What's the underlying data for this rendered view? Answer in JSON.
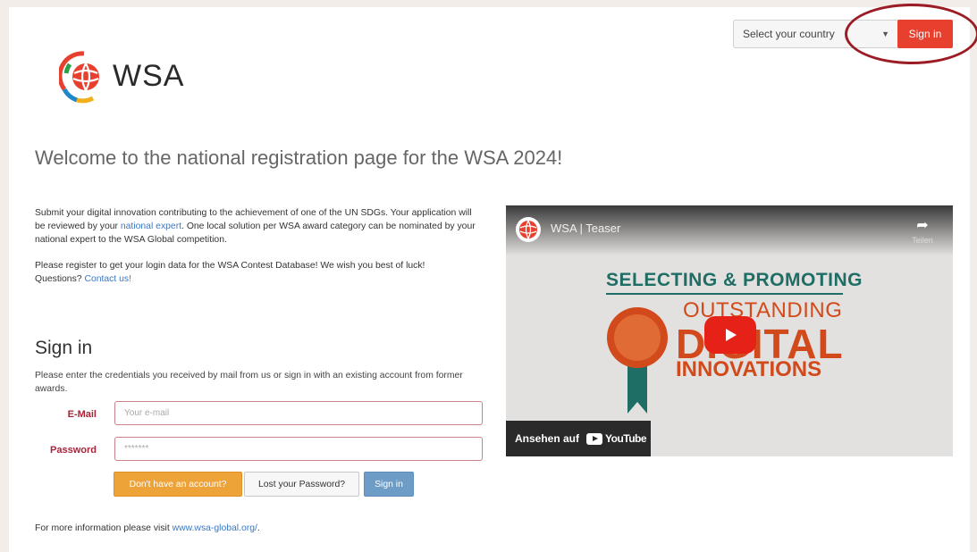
{
  "header": {
    "logo_text": "WSA",
    "country_select": {
      "value": "Select your country"
    },
    "signin_button": "Sign in"
  },
  "main": {
    "welcome_title": "Welcome to the national registration page for the WSA 2024!",
    "intro": {
      "p1_before": "Submit your digital innovation contributing to the achievement of one of the UN SDGs. Your application will be reviewed by your ",
      "p1_link": "national expert",
      "p1_after": ". One local solution per WSA award category can be nominated by your national expert to the WSA Global competition.",
      "p2": "Please register to get your login data for the WSA Contest Database! We wish you best of luck!",
      "p3_before": "Questions? ",
      "p3_link": "Contact us!"
    },
    "signin": {
      "title": "Sign in",
      "description": "Please enter the credentials you received by mail from us or sign in with an existing account from former awards.",
      "email_label": "E-Mail",
      "email_placeholder": "Your e-mail",
      "password_label": "Password",
      "password_value": "*******",
      "no_account_button": "Don't have an account?",
      "lost_password_button": "Lost your Password?",
      "submit_button": "Sign in"
    },
    "footer": {
      "text_before": "For more information please visit ",
      "link": "www.wsa-global.org/",
      "text_after": "."
    }
  },
  "video": {
    "title": "WSA | Teaser",
    "share_label": "Teilen",
    "line1": "SELECTING & PROMOTING",
    "line2": "OUTSTANDING",
    "line3": "DIGITAL",
    "line4": "INNOVATIONS",
    "watch_on": "Ansehen auf",
    "youtube": "YouTube"
  },
  "colors": {
    "signin_red": "#e8402f",
    "annotation_circle": "#9b1c24",
    "orange_button": "#eda338",
    "blue_button": "#6d9cc7",
    "label_red": "#a8243a",
    "link_blue": "#3c78c3"
  }
}
